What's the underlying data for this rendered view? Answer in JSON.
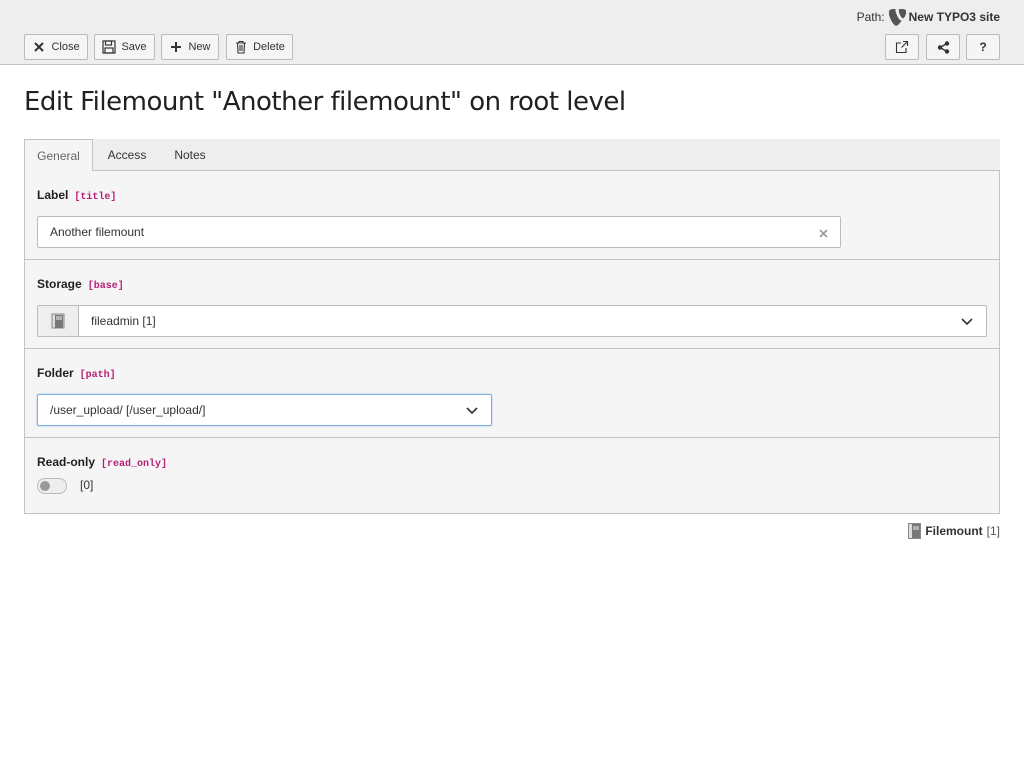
{
  "path": {
    "label": "Path:",
    "site_name": "New TYPO3 site"
  },
  "toolbar": {
    "close_label": "Close",
    "save_label": "Save",
    "new_label": "New",
    "delete_label": "Delete",
    "help_label": "?"
  },
  "page_title": "Edit Filemount \"Another filemount\" on root level",
  "tabs": [
    {
      "label": "General",
      "active": true
    },
    {
      "label": "Access",
      "active": false
    },
    {
      "label": "Notes",
      "active": false
    }
  ],
  "form": {
    "label_field": {
      "label": "Label",
      "code": "[title]",
      "value": "Another filemount"
    },
    "storage_field": {
      "label": "Storage",
      "code": "[base]",
      "value": "fileadmin [1]"
    },
    "folder_field": {
      "label": "Folder",
      "code": "[path]",
      "value": "/user_upload/ [/user_upload/]"
    },
    "readonly_field": {
      "label": "Read-only",
      "code": "[read_only]",
      "value": "[0]",
      "checked": false
    }
  },
  "record": {
    "type": "Filemount",
    "id": "[1]"
  },
  "icons": {
    "close": "close-icon",
    "save": "save-icon",
    "new": "plus-icon",
    "delete": "trash-icon",
    "open": "open-new-window-icon",
    "share": "share-icon",
    "storage": "file-storage-icon",
    "chevron": "chevron-down-icon",
    "logo": "typo3-logo-icon"
  },
  "colors": {
    "docheader_bg": "#eeeeee",
    "field_code": "#b61f77",
    "focus_border": "#7fb1e6"
  }
}
